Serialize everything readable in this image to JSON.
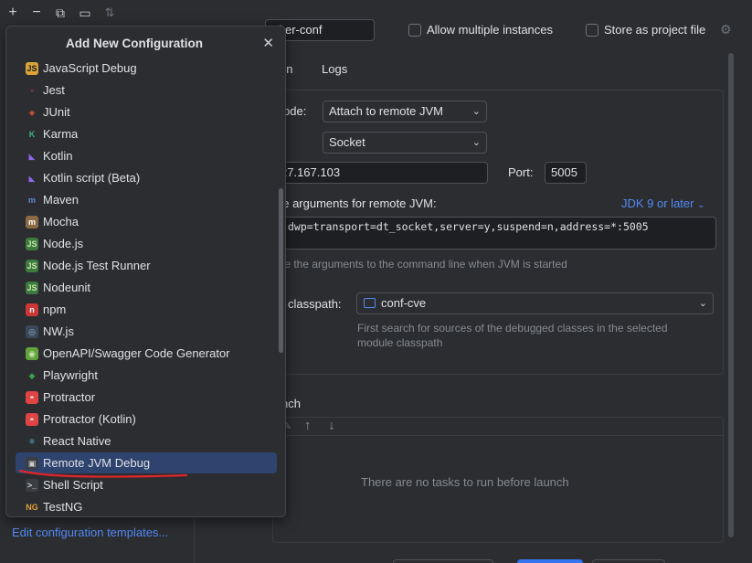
{
  "toolbar": {
    "add": "+",
    "remove": "−",
    "copy": "⧉",
    "folder": "▭",
    "sort": "⇅"
  },
  "config": {
    "name_value": "cker-conf",
    "allow_multiple": "Allow multiple instances",
    "store_as_project": "Store as project file"
  },
  "tabs": {
    "config_tab": "on",
    "logs_tab": "Logs"
  },
  "debugger": {
    "mode_label": "ode:",
    "mode_value": "Attach to remote JVM",
    "transport_value": "Socket",
    "host_value": "27.167.103",
    "port_label": "Port:",
    "port_value": "5005",
    "args_label": "ne arguments for remote JVM:",
    "jdk_link": "JDK 9 or later",
    "args_value": "dwp=transport=dt_socket,server=y,suspend=n,address=*:5005",
    "args_hint": "ste the arguments to the command line when JVM is started",
    "classpath_label": "classpath:",
    "classpath_value": "conf-cve",
    "classpath_hint_1": "First search for sources of the debugged classes in the selected",
    "classpath_hint_2": "module classpath"
  },
  "before_launch": {
    "title": "nch",
    "empty": "There are no tasks to run before launch"
  },
  "popup": {
    "title": "Add New Configuration",
    "close": "✕",
    "items": [
      {
        "label": "JavaScript Debug"
      },
      {
        "label": "Jest"
      },
      {
        "label": "JUnit"
      },
      {
        "label": "Karma"
      },
      {
        "label": "Kotlin"
      },
      {
        "label": "Kotlin script (Beta)"
      },
      {
        "label": "Maven"
      },
      {
        "label": "Mocha"
      },
      {
        "label": "Node.js"
      },
      {
        "label": "Node.js Test Runner"
      },
      {
        "label": "Nodeunit"
      },
      {
        "label": "npm"
      },
      {
        "label": "NW.js"
      },
      {
        "label": "OpenAPI/Swagger Code Generator"
      },
      {
        "label": "Playwright"
      },
      {
        "label": "Protractor"
      },
      {
        "label": "Protractor (Kotlin)"
      },
      {
        "label": "React Native"
      },
      {
        "label": "Remote JVM Debug"
      },
      {
        "label": "Shell Script"
      },
      {
        "label": "TestNG"
      }
    ]
  },
  "edit_templates": "Edit configuration templates...",
  "colors": {
    "accent": "#548af7",
    "selection": "#2e436e",
    "annotation": "#e0262a"
  }
}
